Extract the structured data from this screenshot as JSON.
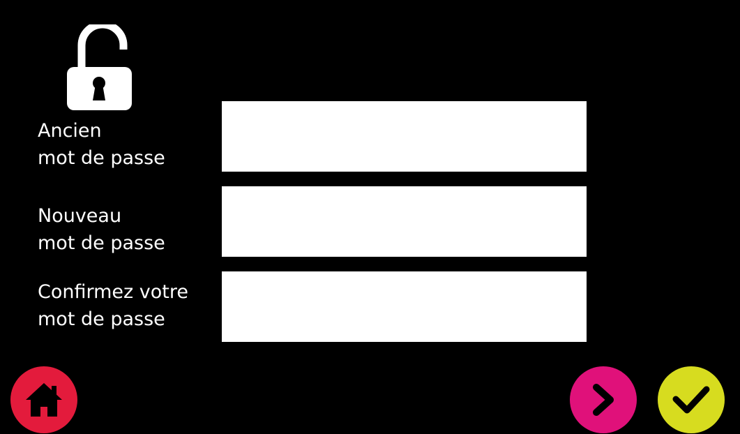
{
  "header": {
    "icon": "unlocked-padlock-icon"
  },
  "form": {
    "fields": [
      {
        "label_line1": "Ancien",
        "label_line2": "mot de passe",
        "value": "",
        "type": "password"
      },
      {
        "label_line1": "Nouveau",
        "label_line2": "mot de passe",
        "value": "",
        "type": "password"
      },
      {
        "label_line1": "Confirmez votre",
        "label_line2": "mot de passe",
        "value": "",
        "type": "password"
      }
    ]
  },
  "footer": {
    "home_button": {
      "icon": "home-icon",
      "color": "#e31b3c"
    },
    "next_button": {
      "icon": "chevron-right-icon",
      "color": "#e0117a"
    },
    "confirm_button": {
      "icon": "checkmark-icon",
      "color": "#d7dc1f"
    }
  },
  "colors": {
    "background": "#000000",
    "text": "#ffffff",
    "input_background": "#ffffff"
  }
}
